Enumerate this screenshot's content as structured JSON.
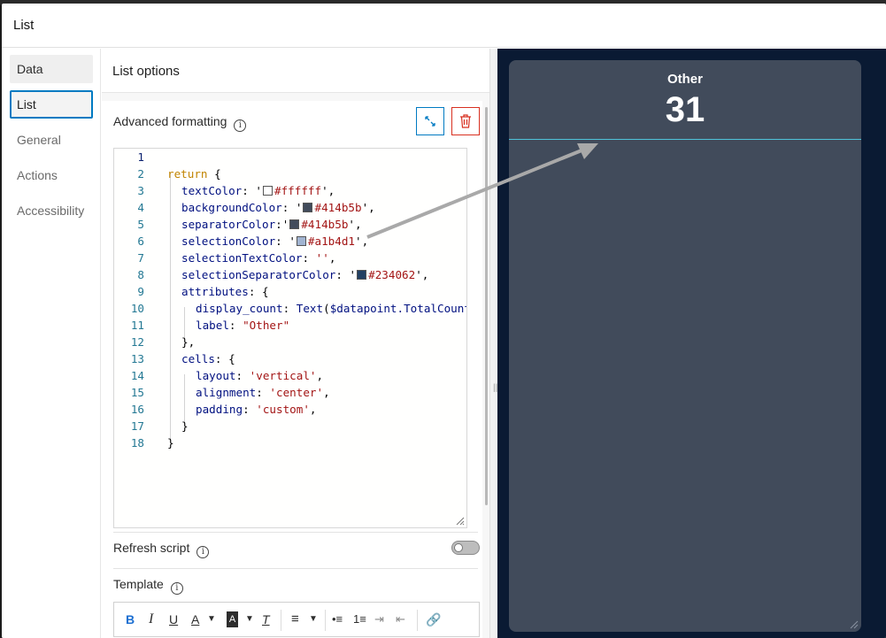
{
  "dialog": {
    "title": "List"
  },
  "nav": {
    "items": [
      {
        "label": "Data"
      },
      {
        "label": "List"
      },
      {
        "label": "General"
      },
      {
        "label": "Actions"
      },
      {
        "label": "Accessibility"
      }
    ],
    "active": "List"
  },
  "panel": {
    "title": "List options",
    "advanced_formatting_label": "Advanced formatting",
    "refresh_script_label": "Refresh script",
    "refresh_script_enabled": false,
    "template_label": "Template"
  },
  "code": {
    "line_numbers": [
      "1",
      "2",
      "3",
      "4",
      "5",
      "6",
      "7",
      "8",
      "9",
      "10",
      "11",
      "12",
      "13",
      "14",
      "15",
      "16",
      "17",
      "18"
    ],
    "lines": [
      {
        "tokens": []
      },
      {
        "tokens": [
          {
            "t": "return",
            "c": "kwr"
          },
          {
            "t": " {",
            "c": "punc"
          }
        ]
      },
      {
        "indent": 1,
        "tokens": [
          {
            "t": "textColor",
            "c": "prop"
          },
          {
            "t": ": '",
            "c": "punc"
          },
          {
            "swatch": "#ffffff"
          },
          {
            "t": "#ffffff",
            "c": "str"
          },
          {
            "t": "',",
            "c": "punc"
          }
        ]
      },
      {
        "indent": 1,
        "tokens": [
          {
            "t": "backgroundColor",
            "c": "prop"
          },
          {
            "t": ": '",
            "c": "punc"
          },
          {
            "swatch": "#414b5b"
          },
          {
            "t": "#414b5b",
            "c": "str"
          },
          {
            "t": "',",
            "c": "punc"
          }
        ]
      },
      {
        "indent": 1,
        "tokens": [
          {
            "t": "separatorColor",
            "c": "prop"
          },
          {
            "t": ":'",
            "c": "punc"
          },
          {
            "swatch": "#414b5b"
          },
          {
            "t": "#414b5b",
            "c": "str"
          },
          {
            "t": "',",
            "c": "punc"
          }
        ]
      },
      {
        "indent": 1,
        "tokens": [
          {
            "t": "selectionColor",
            "c": "prop"
          },
          {
            "t": ": '",
            "c": "punc"
          },
          {
            "swatch": "#a1b4d1"
          },
          {
            "t": "#a1b4d1",
            "c": "str"
          },
          {
            "t": "',",
            "c": "punc"
          }
        ]
      },
      {
        "indent": 1,
        "tokens": [
          {
            "t": "selectionTextColor",
            "c": "prop"
          },
          {
            "t": ": ",
            "c": "punc"
          },
          {
            "t": "''",
            "c": "str"
          },
          {
            "t": ",",
            "c": "punc"
          }
        ]
      },
      {
        "indent": 1,
        "tokens": [
          {
            "t": "selectionSeparatorColor",
            "c": "prop"
          },
          {
            "t": ": '",
            "c": "punc"
          },
          {
            "swatch": "#234062"
          },
          {
            "t": "#234062",
            "c": "str"
          },
          {
            "t": "',",
            "c": "punc"
          }
        ]
      },
      {
        "indent": 1,
        "tokens": [
          {
            "t": "attributes",
            "c": "prop"
          },
          {
            "t": ": {",
            "c": "punc"
          }
        ]
      },
      {
        "indent": 2,
        "tokens": [
          {
            "t": "display_count",
            "c": "prop"
          },
          {
            "t": ": ",
            "c": "punc"
          },
          {
            "t": "Text",
            "c": "prop"
          },
          {
            "t": "(",
            "c": "punc"
          },
          {
            "t": "$datapoint.TotalCount",
            "c": "prop"
          },
          {
            "t": ",",
            "c": "punc"
          }
        ]
      },
      {
        "indent": 2,
        "tokens": [
          {
            "t": "label",
            "c": "prop"
          },
          {
            "t": ": ",
            "c": "punc"
          },
          {
            "t": "\"Other\"",
            "c": "str"
          }
        ]
      },
      {
        "indent": 1,
        "tokens": [
          {
            "t": "},",
            "c": "punc"
          }
        ]
      },
      {
        "indent": 1,
        "tokens": [
          {
            "t": "cells",
            "c": "prop"
          },
          {
            "t": ": {",
            "c": "punc"
          }
        ]
      },
      {
        "indent": 2,
        "tokens": [
          {
            "t": "layout",
            "c": "prop"
          },
          {
            "t": ": ",
            "c": "punc"
          },
          {
            "t": "'vertical'",
            "c": "str"
          },
          {
            "t": ",",
            "c": "punc"
          }
        ]
      },
      {
        "indent": 2,
        "tokens": [
          {
            "t": "alignment",
            "c": "prop"
          },
          {
            "t": ": ",
            "c": "punc"
          },
          {
            "t": "'center'",
            "c": "str"
          },
          {
            "t": ",",
            "c": "punc"
          }
        ]
      },
      {
        "indent": 2,
        "tokens": [
          {
            "t": "padding",
            "c": "prop"
          },
          {
            "t": ": ",
            "c": "punc"
          },
          {
            "t": "'custom'",
            "c": "str"
          },
          {
            "t": ",",
            "c": "punc"
          }
        ]
      },
      {
        "indent": 1,
        "tokens": [
          {
            "t": "}",
            "c": "punc"
          }
        ]
      },
      {
        "indent": 0,
        "tokens": [
          {
            "t": "}",
            "c": "punc"
          }
        ]
      }
    ]
  },
  "toolbar": {
    "bold": "B",
    "italic": "I",
    "underline": "U",
    "font_color": "A",
    "highlight": "A",
    "clear_format": "T"
  },
  "preview": {
    "label": "Other",
    "count": "31",
    "background_color": "#414b5b",
    "separator_color": "#4fc3d9"
  },
  "colors": {
    "accent": "#007ac2",
    "danger": "#d83020"
  }
}
